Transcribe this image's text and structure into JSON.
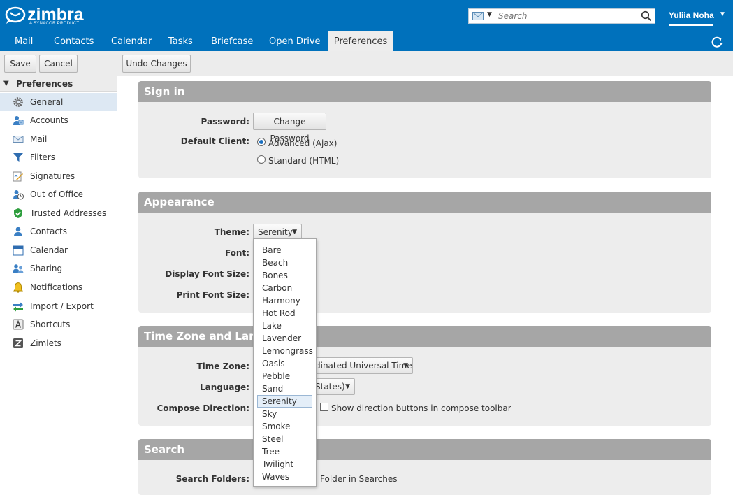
{
  "header": {
    "logo_text": "zimbra",
    "logo_sub": "A SYNACOR PRODUCT",
    "search_placeholder": "Search",
    "user_name": "Yuliia Noha"
  },
  "tabs": [
    "Mail",
    "Contacts",
    "Calendar",
    "Tasks",
    "Briefcase",
    "Open Drive",
    "Preferences"
  ],
  "active_tab": "Preferences",
  "toolbar": {
    "save": "Save",
    "cancel": "Cancel",
    "undo": "Undo Changes"
  },
  "sidebar": {
    "title": "Preferences",
    "items": [
      {
        "label": "General",
        "icon": "gear-icon"
      },
      {
        "label": "Accounts",
        "icon": "accounts-icon"
      },
      {
        "label": "Mail",
        "icon": "envelope-icon"
      },
      {
        "label": "Filters",
        "icon": "filter-icon"
      },
      {
        "label": "Signatures",
        "icon": "signature-icon"
      },
      {
        "label": "Out of Office",
        "icon": "out-of-office-icon"
      },
      {
        "label": "Trusted Addresses",
        "icon": "shield-check-icon"
      },
      {
        "label": "Contacts",
        "icon": "contact-icon"
      },
      {
        "label": "Calendar",
        "icon": "calendar-icon"
      },
      {
        "label": "Sharing",
        "icon": "sharing-icon"
      },
      {
        "label": "Notifications",
        "icon": "bell-icon"
      },
      {
        "label": "Import / Export",
        "icon": "import-export-icon"
      },
      {
        "label": "Shortcuts",
        "icon": "shortcuts-icon"
      },
      {
        "label": "Zimlets",
        "icon": "zimlet-icon"
      }
    ]
  },
  "signin": {
    "title": "Sign in",
    "password_label": "Password:",
    "change_password": "Change Password",
    "default_client_label": "Default Client:",
    "advanced": "Advanced (Ajax)",
    "standard": "Standard (HTML)"
  },
  "appearance": {
    "title": "Appearance",
    "theme_label": "Theme:",
    "theme_value": "Serenity",
    "font_label": "Font:",
    "display_font_label": "Display Font Size:",
    "print_font_label": "Print Font Size:"
  },
  "timezone": {
    "title": "Time Zone and Lang",
    "tz_label": "Time Zone:",
    "tz_value": "dinated Universal Time",
    "language_label": "Language:",
    "language_value": "States)",
    "compose_label": "Compose Direction:",
    "compose_text": "Show direction buttons in compose toolbar"
  },
  "search": {
    "title": "Search",
    "folders_label": "Search Folders:",
    "folders_text": "Folder in Searches"
  },
  "theme_options": [
    "Bare",
    "Beach",
    "Bones",
    "Carbon",
    "Harmony",
    "Hot Rod",
    "Lake",
    "Lavender",
    "Lemongrass",
    "Oasis",
    "Pebble",
    "Sand",
    "Serenity",
    "Sky",
    "Smoke",
    "Steel",
    "Tree",
    "Twilight",
    "Waves"
  ],
  "theme_selected": "Serenity",
  "colors": {
    "brand": "#0071bc",
    "section_header": "#a6a6a6"
  }
}
